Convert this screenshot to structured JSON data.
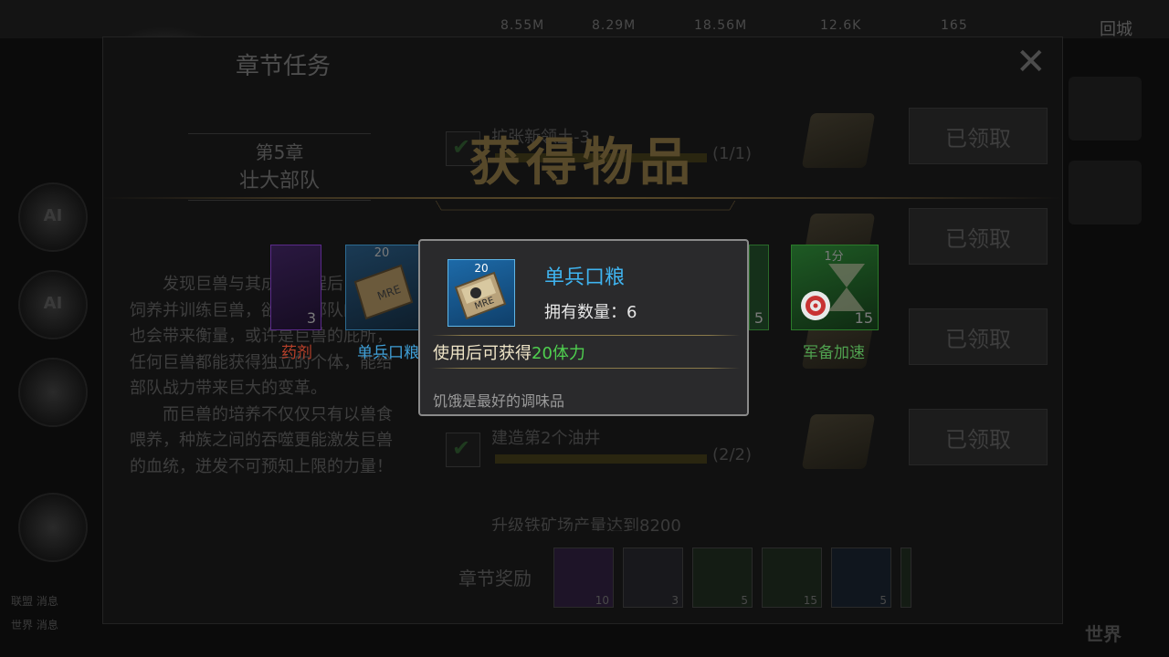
{
  "hud": {
    "resources": [
      "8.55M",
      "8.29M",
      "18.56M",
      "12.6K",
      "165"
    ],
    "right_label": "回城",
    "world_label": "世界",
    "chat_lines": [
      "联盟 消息",
      "世界 消息"
    ]
  },
  "panel": {
    "title": "章节任务",
    "close_icon": "close-icon",
    "chapter_num": "第5章",
    "chapter_name": "壮大部队",
    "story_paragraphs": [
      "发现巨兽与其成长过程后，立即饲养并训练巨兽，欲望，部队的实力也会带来衡量，或许是巨兽的庇所，任何巨兽都能获得独立的个体，能给部队战力带来巨大的变革。",
      "而巨兽的培养不仅仅只有以兽食喂养，种族之间的吞噬更能激发巨兽的血统，迸发不可预知上限的力量！"
    ],
    "tasks": [
      {
        "name": "扩张新领土-3",
        "progress": "(1/1)",
        "claim": "已领取"
      },
      {
        "name": "",
        "progress": "",
        "claim": "已领取"
      },
      {
        "name": "",
        "progress": "",
        "claim": "已领取"
      },
      {
        "name": "建造第2个油井",
        "progress": "(2/2)",
        "claim": "已领取"
      },
      {
        "name": "升级铁矿场产量达到8200",
        "progress": "",
        "claim": ""
      }
    ],
    "chapter_reward_label": "章节奖励",
    "chapter_rewards": [
      "10",
      "3",
      "5",
      "15",
      "5"
    ]
  },
  "obtained": {
    "title": "获得物品",
    "items": [
      {
        "name": "药剂",
        "top": "",
        "count": "3",
        "name_color": "#b8402a",
        "frame": "#5a2a8a",
        "icon": "syringe-icon"
      },
      {
        "name": "单兵口粮",
        "top": "20",
        "count": "",
        "name_color": "#3fa0d8",
        "frame": "#2c6a90",
        "icon": "ration-icon"
      },
      {
        "name": "",
        "top": "",
        "count": "5",
        "name_color": "#4fa04f",
        "frame": "#2a6a2a",
        "icon": "speedup-icon"
      },
      {
        "name": "军备加速",
        "top": "1分",
        "count": "15",
        "name_color": "#4fa04f",
        "frame": "#2a7a2a",
        "icon": "target-icon"
      }
    ]
  },
  "tooltip": {
    "icon": "ration-icon",
    "icon_count": "20",
    "name": "单兵口粮",
    "owned": "拥有数量：6",
    "use_prefix": "使用后可获得",
    "use_value": "20体力",
    "description": "饥饿是最好的调味品"
  }
}
